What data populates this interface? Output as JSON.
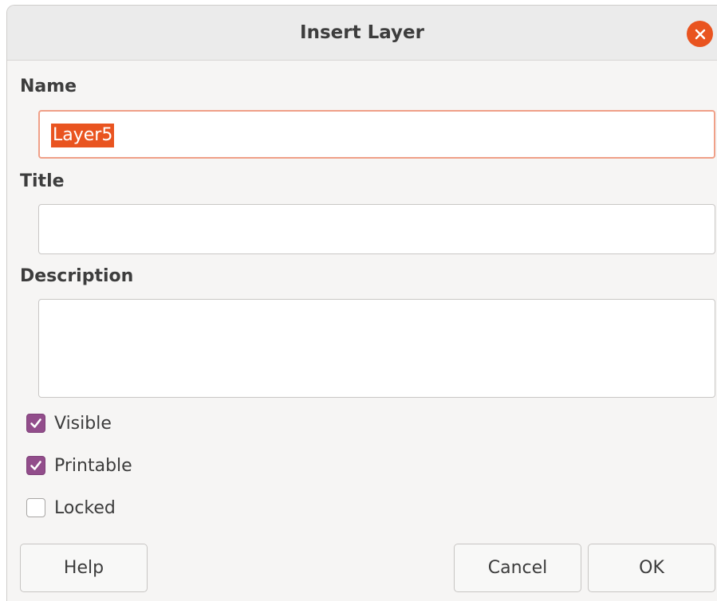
{
  "dialog": {
    "title": "Insert Layer"
  },
  "name": {
    "label": "Name",
    "value": "Layer5"
  },
  "title_field": {
    "label": "Title",
    "value": ""
  },
  "description": {
    "label": "Description",
    "value": ""
  },
  "options": {
    "visible": {
      "label": "Visible",
      "checked": true
    },
    "printable": {
      "label": "Printable",
      "checked": true
    },
    "locked": {
      "label": "Locked",
      "checked": false
    }
  },
  "buttons": {
    "help": "Help",
    "cancel": "Cancel",
    "ok": "OK"
  },
  "colors": {
    "accent": "#e95420",
    "checkbox": "#924d8b"
  },
  "icons": {
    "close": "close-icon",
    "check": "checkmark-icon"
  }
}
